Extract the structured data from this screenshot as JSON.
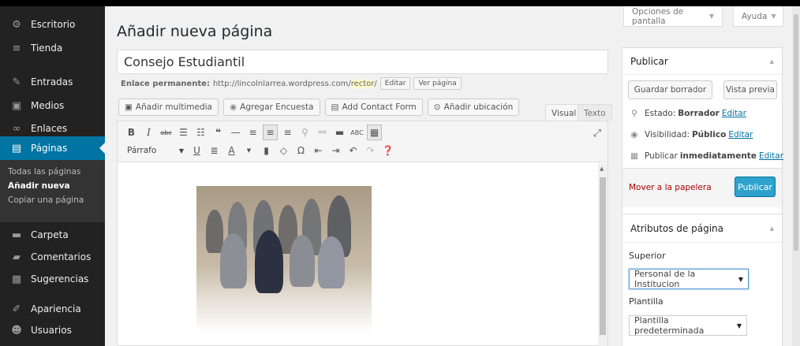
{
  "sidebar": {
    "items": [
      {
        "label": "Escritorio",
        "icon": "dashboard-icon",
        "glyph": "⚙"
      },
      {
        "label": "Tienda",
        "icon": "cart-icon",
        "glyph": "🛒"
      },
      {
        "label": "Entradas",
        "icon": "pin-icon",
        "glyph": "✎"
      },
      {
        "label": "Medios",
        "icon": "media-icon",
        "glyph": "▣"
      },
      {
        "label": "Enlaces",
        "icon": "link-icon",
        "glyph": "🔗"
      },
      {
        "label": "Páginas",
        "icon": "pages-icon",
        "glyph": "▤"
      },
      {
        "label": "Carpeta",
        "icon": "folder-icon",
        "glyph": "▬"
      },
      {
        "label": "Comentarios",
        "icon": "comment-icon",
        "glyph": "▰"
      },
      {
        "label": "Sugerencias",
        "icon": "feedback-icon",
        "glyph": "▦"
      },
      {
        "label": "Apariencia",
        "icon": "appearance-icon",
        "glyph": "✐"
      },
      {
        "label": "Usuarios",
        "icon": "users-icon",
        "glyph": "☻"
      }
    ],
    "submenu": [
      "Todas las páginas",
      "Añadir nueva",
      "Copiar una página"
    ]
  },
  "screen_options": "Opciones de pantalla",
  "help": "Ayuda",
  "page_title": "Añadir nueva página",
  "post_title": "Consejo Estudiantil",
  "permalink": {
    "label": "Enlace permanente:",
    "base": "http://lincolnlarrea.wordpress.com/",
    "slug": "rector",
    "edit": "Editar",
    "view": "Ver página"
  },
  "media_buttons": {
    "add_media": "Añadir multimedia",
    "poll": "Agregar Encuesta",
    "contact": "Add Contact Form",
    "location": "Añadir ubicación"
  },
  "editor_tabs": {
    "visual": "Visual",
    "text": "Texto"
  },
  "format_select": "Párrafo",
  "publish_box": {
    "title": "Publicar",
    "save_draft": "Guardar borrador",
    "preview": "Vista previa",
    "status_label": "Estado:",
    "status_value": "Borrador",
    "visibility_label": "Visibilidad:",
    "visibility_value": "Público",
    "publish_label": "Publicar",
    "publish_value": "inmediatamente",
    "edit": "Editar",
    "trash": "Mover a la papelera",
    "publish_button": "Publicar"
  },
  "attributes_box": {
    "title": "Atributos de página",
    "parent_label": "Superior",
    "parent_value": "Personal de la Institucion",
    "template_label": "Plantilla",
    "template_value": "Plantilla predeterminada"
  },
  "colors": {
    "accent": "#0074a2",
    "sidebar": "#222222",
    "publish": "#2ea2cc"
  }
}
